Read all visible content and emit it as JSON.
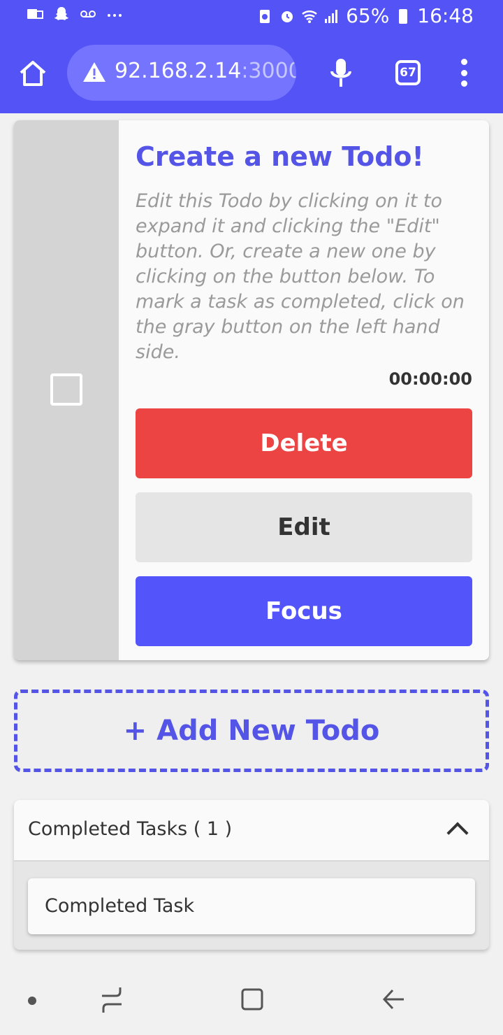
{
  "status_bar": {
    "battery": "65%",
    "time": "16:48"
  },
  "browser": {
    "url_host": "92.168.2.14",
    "url_port": ":3000",
    "tab_count": "67"
  },
  "todo": {
    "title": "Create a new Todo!",
    "description": "Edit this Todo by clicking on it to expand it and clicking the \"Edit\" button. Or, create a new one by clicking on the button below. To mark a task as completed, click on the gray button on the left hand side.",
    "timer": "00:00:00",
    "delete_label": "Delete",
    "edit_label": "Edit",
    "focus_label": "Focus"
  },
  "add_new_label": "+ Add New Todo",
  "completed": {
    "title": "Completed Tasks ( 1 )",
    "items": [
      "Completed Task"
    ]
  },
  "colors": {
    "accent": "#5454f6",
    "delete": "#ec4343",
    "edit": "#e5e5e5"
  }
}
